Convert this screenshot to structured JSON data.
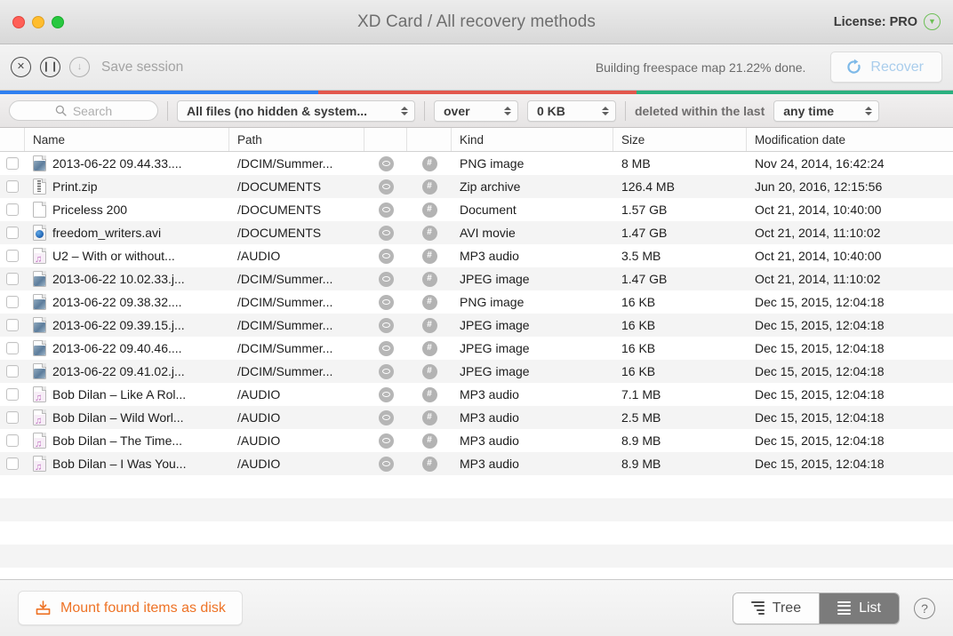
{
  "titlebar": {
    "title": "XD Card / All recovery methods",
    "license_label": "License: PRO",
    "license_badge_icon": "chevron-down-circle-icon",
    "traffic_lights": [
      "close",
      "minimize",
      "zoom"
    ]
  },
  "toolbar": {
    "stop_icon": "stop-circle-icon",
    "pause_icon": "pause-circle-icon",
    "download_icon": "download-circle-icon",
    "save_session_label": "Save session",
    "status_text": "Building freespace map 21.22% done.",
    "recover_label": "Recover",
    "recover_icon": "refresh-icon",
    "recover_color": "#a9cdec"
  },
  "progress_stripe": {
    "segments": [
      {
        "name": "blue-segment",
        "color": "#2f7ff0",
        "width_pct": 33.4
      },
      {
        "name": "red-segment",
        "color": "#e2574c",
        "width_pct": 33.4
      },
      {
        "name": "green-segment",
        "color": "#2bb07f",
        "width_pct": 33.2
      }
    ]
  },
  "filterbar": {
    "search_placeholder": "Search",
    "search_value": "",
    "search_icon": "search-icon",
    "kind_filter": "All files (no hidden & system...",
    "comparator": "over",
    "size_value": "0 KB",
    "deleted_label": "deleted within the last",
    "time_filter": "any time"
  },
  "table": {
    "columns": [
      "",
      "Name",
      "Path",
      "",
      "",
      "Kind",
      "Size",
      "Modification date"
    ],
    "rows": [
      {
        "name": "2013-06-22 09.44.33....",
        "icon": "photo",
        "path": "/DCIM/Summer...",
        "kind": "PNG image",
        "size": "8 MB",
        "date": "Nov 24, 2014, 16:42:24"
      },
      {
        "name": "Print.zip",
        "icon": "zip",
        "path": "/DOCUMENTS",
        "kind": "Zip archive",
        "size": "126.4 MB",
        "date": "Jun 20, 2016, 12:15:56"
      },
      {
        "name": "Priceless 200",
        "icon": "doc",
        "path": "/DOCUMENTS",
        "kind": "Document",
        "size": "1.57 GB",
        "date": "Oct 21, 2014, 10:40:00"
      },
      {
        "name": "freedom_writers.avi",
        "icon": "avi",
        "path": "/DOCUMENTS",
        "kind": "AVI movie",
        "size": "1.47 GB",
        "date": "Oct 21, 2014, 11:10:02"
      },
      {
        "name": "U2 – With or without...",
        "icon": "mp3",
        "path": "/AUDIO",
        "kind": "MP3 audio",
        "size": "3.5 MB",
        "date": "Oct 21, 2014, 10:40:00"
      },
      {
        "name": "2013-06-22 10.02.33.j...",
        "icon": "photo",
        "path": "/DCIM/Summer...",
        "kind": "JPEG image",
        "size": "1.47 GB",
        "date": "Oct 21, 2014, 11:10:02"
      },
      {
        "name": "2013-06-22 09.38.32....",
        "icon": "photo",
        "path": "/DCIM/Summer...",
        "kind": "PNG image",
        "size": "16 KB",
        "date": "Dec 15, 2015, 12:04:18"
      },
      {
        "name": "2013-06-22 09.39.15.j...",
        "icon": "photo",
        "path": "/DCIM/Summer...",
        "kind": "JPEG image",
        "size": "16 KB",
        "date": "Dec 15, 2015, 12:04:18"
      },
      {
        "name": "2013-06-22 09.40.46....",
        "icon": "photo",
        "path": "/DCIM/Summer...",
        "kind": "JPEG image",
        "size": "16 KB",
        "date": "Dec 15, 2015, 12:04:18"
      },
      {
        "name": "2013-06-22 09.41.02.j...",
        "icon": "photo",
        "path": "/DCIM/Summer...",
        "kind": "JPEG image",
        "size": "16 KB",
        "date": "Dec 15, 2015, 12:04:18"
      },
      {
        "name": "Bob Dilan – Like A Rol...",
        "icon": "mp3",
        "path": "/AUDIO",
        "kind": "MP3 audio",
        "size": "7.1 MB",
        "date": "Dec 15, 2015, 12:04:18"
      },
      {
        "name": "Bob Dilan – Wild Worl...",
        "icon": "mp3",
        "path": "/AUDIO",
        "kind": "MP3 audio",
        "size": "2.5 MB",
        "date": "Dec 15, 2015, 12:04:18"
      },
      {
        "name": "Bob Dilan – The Time...",
        "icon": "mp3",
        "path": "/AUDIO",
        "kind": "MP3 audio",
        "size": "8.9 MB",
        "date": "Dec 15, 2015, 12:04:18"
      },
      {
        "name": "Bob Dilan – I Was You...",
        "icon": "mp3",
        "path": "/AUDIO",
        "kind": "MP3 audio",
        "size": "8.9 MB",
        "date": "Dec 15, 2015, 12:04:18"
      }
    ],
    "empty_row_count": 5,
    "preview_icon": "eye-icon",
    "hex_icon": "hash-icon",
    "checkbox_checked": false
  },
  "bottombar": {
    "mount_label": "Mount found items as disk",
    "mount_icon": "mount-disk-icon",
    "mount_color": "#ee7326",
    "view_modes": [
      {
        "label": "Tree",
        "icon": "tree-view-icon",
        "active": false
      },
      {
        "label": "List",
        "icon": "list-view-icon",
        "active": true
      }
    ],
    "help_label": "?",
    "help_icon": "help-circle-icon"
  }
}
